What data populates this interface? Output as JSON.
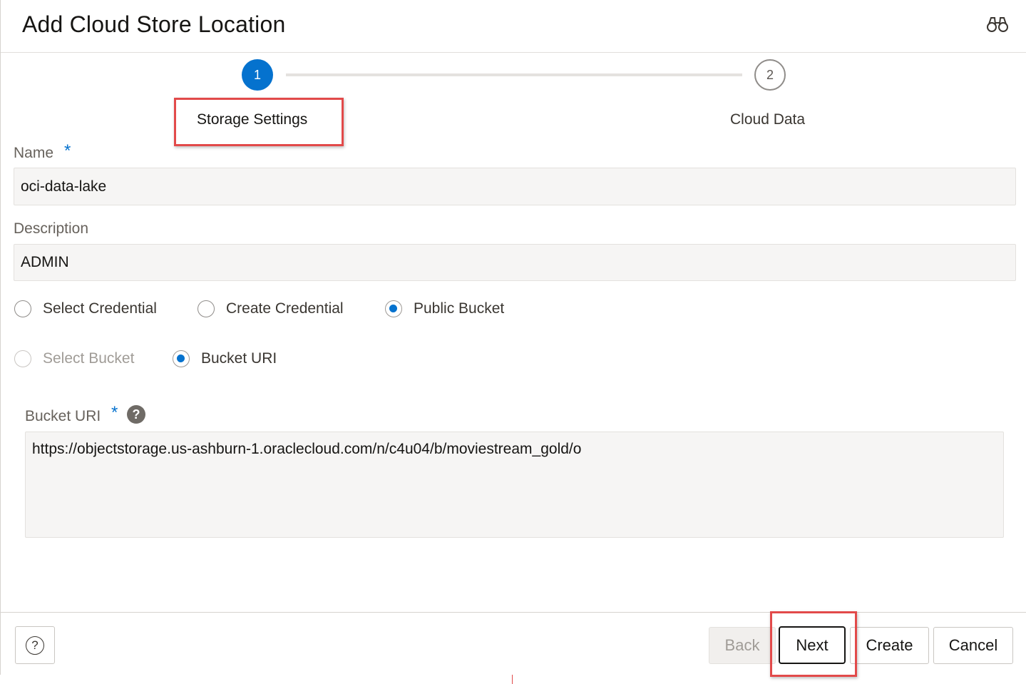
{
  "dialog": {
    "title": "Add Cloud Store Location",
    "search_icon": "binoculars-icon"
  },
  "train": {
    "steps": [
      {
        "number": "1",
        "label": "Storage Settings",
        "state": "current"
      },
      {
        "number": "2",
        "label": "Cloud Data",
        "state": "pending"
      }
    ]
  },
  "form": {
    "name": {
      "label": "Name",
      "required_mark": "*",
      "value": "oci-data-lake"
    },
    "description": {
      "label": "Description",
      "value": "ADMIN"
    },
    "credential_options": [
      {
        "label": "Select Credential",
        "checked": false
      },
      {
        "label": "Create Credential",
        "checked": false
      },
      {
        "label": "Public Bucket",
        "checked": true
      }
    ],
    "bucket_options": [
      {
        "label": "Select Bucket",
        "checked": false,
        "disabled": true
      },
      {
        "label": "Bucket URI",
        "checked": true
      }
    ],
    "bucket_uri": {
      "label": "Bucket URI",
      "required_mark": "*",
      "help_glyph": "?",
      "value": "https://objectstorage.us-ashburn-1.oraclecloud.com/n/c4u04/b/moviestream_gold/o"
    }
  },
  "footer": {
    "help_glyph": "?",
    "back_label": "Back",
    "next_label": "Next",
    "create_label": "Create",
    "cancel_label": "Cancel"
  },
  "colors": {
    "accent": "#0572ce",
    "highlight": "#e24a4a"
  }
}
